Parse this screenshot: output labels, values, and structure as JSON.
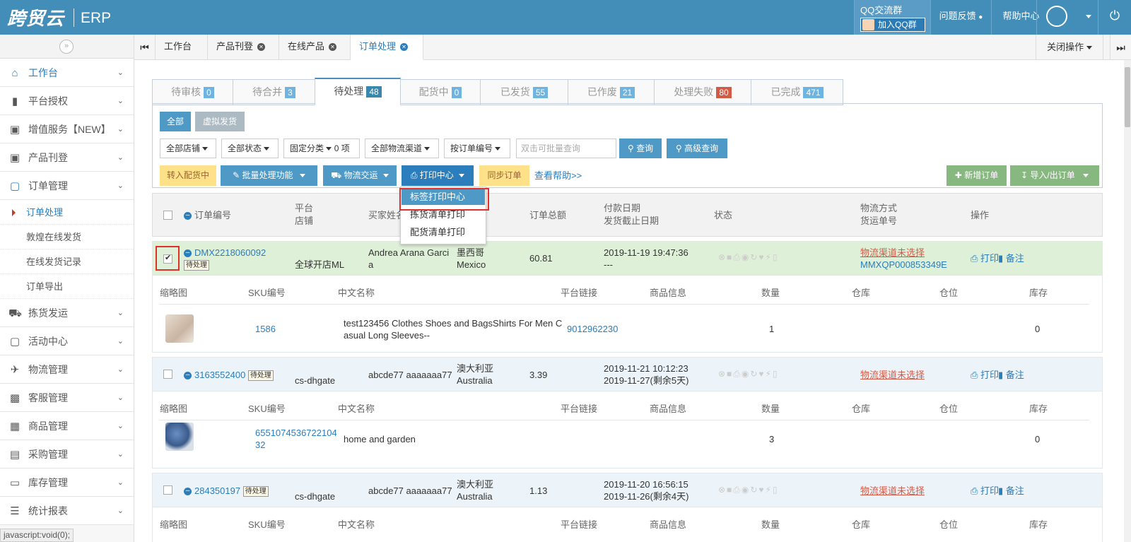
{
  "topbar": {
    "logo_text": "跨贸云",
    "product": "ERP",
    "qq_title": "QQ交流群",
    "qq_join": "加入QQ群",
    "feedback": "问题反馈",
    "help": "帮助中心"
  },
  "sidebar": {
    "items": [
      {
        "label": "工作台",
        "icon": "home-icon"
      },
      {
        "label": "平台授权",
        "icon": "bookmark-icon"
      },
      {
        "label": "增值服务【NEW】",
        "icon": "box-icon"
      },
      {
        "label": "产品刊登",
        "icon": "box-icon"
      },
      {
        "label": "订单管理",
        "icon": "file-icon"
      },
      {
        "label": "拣货发运",
        "icon": "truck-icon"
      },
      {
        "label": "活动中心",
        "icon": "file-icon"
      },
      {
        "label": "物流管理",
        "icon": "plane-icon"
      },
      {
        "label": "客服管理",
        "icon": "briefcase-icon"
      },
      {
        "label": "商品管理",
        "icon": "gift-icon"
      },
      {
        "label": "采购管理",
        "icon": "cart-icon"
      },
      {
        "label": "库存管理",
        "icon": "inbox-icon"
      },
      {
        "label": "统计报表",
        "icon": "list-icon"
      }
    ],
    "sub_items": [
      "订单处理",
      "敦煌在线发货",
      "在线发货记录",
      "订单导出"
    ]
  },
  "status_url": "javascript:void(0);",
  "tabs": {
    "items": [
      "工作台",
      "产品刊登",
      "在线产品",
      "订单处理"
    ],
    "close_ops": "关闭操作"
  },
  "status_tabs": [
    {
      "label": "待审核",
      "count": "0"
    },
    {
      "label": "待合并",
      "count": "3"
    },
    {
      "label": "待处理",
      "count": "48"
    },
    {
      "label": "配货中",
      "count": "0"
    },
    {
      "label": "已发货",
      "count": "55"
    },
    {
      "label": "已作废",
      "count": "21"
    },
    {
      "label": "处理失败",
      "count": "80"
    },
    {
      "label": "已完成",
      "count": "471"
    }
  ],
  "filters": {
    "all": "全部",
    "virtual": "虚拟发货",
    "store": "全部店铺",
    "status": "全部状态",
    "fixed_category": "固定分类",
    "fixed_count": "0",
    "fixed_unit": "项",
    "channel": "全部物流渠道",
    "by_order": "按订单编号",
    "search_placeholder": "双击可批量查询",
    "query": "查询",
    "advanced": "高级查询"
  },
  "toolbar": {
    "to_allocate": "转入配货中",
    "batch": "批量处理功能",
    "logistics": "物流交运",
    "print_center": "打印中心",
    "sync": "同步订单",
    "help": "查看帮助>>",
    "new_order": "新增订单",
    "import_export": "导入/出订单"
  },
  "print_menu": [
    "标签打印中心",
    "拣货清单打印",
    "配货清单打印"
  ],
  "table_header": {
    "order_no": "订单编号",
    "platform": "平台",
    "store": "店铺",
    "buyer": "买家姓名",
    "total": "订单总额",
    "pay_date": "付款日期",
    "ship_deadline": "发货截止日期",
    "status": "状态",
    "shipping": "物流方式",
    "tracking": "货运单号",
    "ops": "操作"
  },
  "sub_header": {
    "thumb": "缩略图",
    "sku": "SKU编号",
    "cn_name": "中文名称",
    "link": "平台链接",
    "info": "商品信息",
    "qty": "数量",
    "warehouse": "仓库",
    "location": "仓位",
    "stock": "库存"
  },
  "orders": [
    {
      "order_no": "DMX2218060092",
      "tag": "待处理",
      "store": "全球开店ML",
      "buyer_line1": "Andrea Arana Garci",
      "buyer_line2": "a",
      "country_cn": "墨西哥",
      "country_en": "Mexico",
      "total": "60.81",
      "pay_date": "2019-11-19 19:47:36",
      "deadline": "---",
      "shipping": "物流渠道未选择",
      "tracking": "MMXQP000853349E",
      "print": "打印",
      "note": "备注",
      "sku": "1586",
      "sku_line2": "",
      "name_line1": "test123456 Clothes Shoes and BagsShirts For Men C",
      "name_line2": "asual Long Sleeves--",
      "link": "9012962230",
      "qty": "1",
      "stock": "0"
    },
    {
      "order_no": "3163552400",
      "tag": "待处理",
      "store": "cs-dhgate",
      "buyer_line1": "abcde77 aaaaaaa77",
      "buyer_line2": "",
      "country_cn": "澳大利亚",
      "country_en": "Australia",
      "total": "3.39",
      "pay_date": "2019-11-21 10:12:23",
      "deadline": "2019-11-27(剩余5天)",
      "shipping": "物流渠道未选择",
      "tracking": "",
      "print": "打印",
      "note": "备注",
      "sku": "6551074536722104",
      "sku_line2": "32",
      "name_line1": "home and garden",
      "name_line2": "",
      "link": "",
      "qty": "3",
      "stock": "0"
    },
    {
      "order_no": "284350197",
      "tag": "待处理",
      "store": "cs-dhgate",
      "buyer_line1": "abcde77 aaaaaaa77",
      "buyer_line2": "",
      "country_cn": "澳大利亚",
      "country_en": "Australia",
      "total": "1.13",
      "pay_date": "2019-11-20 16:56:15",
      "deadline": "2019-11-26(剩余4天)",
      "shipping": "物流渠道未选择",
      "tracking": "",
      "print": "打印",
      "note": "备注"
    }
  ],
  "colors": {
    "topbar": "#438eb9",
    "accent_blue": "#2b7dbc",
    "btn_blue": "#4f99c6",
    "btn_yellow": "#fee188",
    "btn_green": "#87b87f",
    "btn_grey": "#abbac3",
    "highlight_red": "#e0322a"
  }
}
